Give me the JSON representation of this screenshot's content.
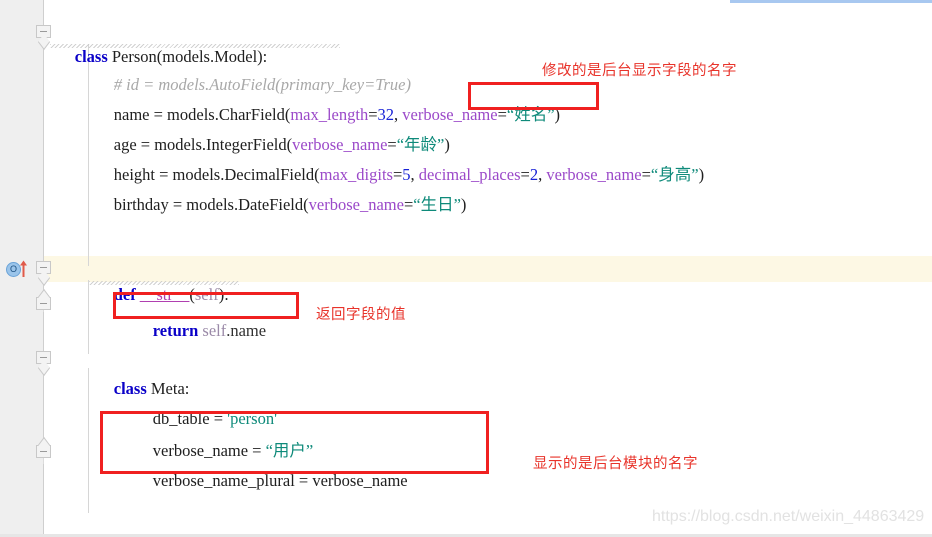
{
  "editor": {
    "background_color": "#ffffff",
    "gutter_color": "#efefef",
    "current_line_highlight_color": "#fdf8e4",
    "top_marker_bar_color": "#a8c8f0",
    "annotation_color": "#f02020"
  },
  "gutter": {
    "override_icon_letter": "O",
    "override_icon_title": "Overrides method in Model",
    "fold_markers": [
      "fold-class-person",
      "fold-def-str",
      "fold-def-str-body",
      "fold-class-meta",
      "fold-class-meta-body"
    ]
  },
  "code": {
    "lines": [
      {
        "id": "line-class-person",
        "indent": 0,
        "tokens": [
          {
            "t": "class ",
            "c": "kw"
          },
          {
            "t": "Person",
            "c": "ident"
          },
          {
            "t": "(models.Model):",
            "c": "ident"
          }
        ],
        "plain": "class Person(models.Model):"
      },
      {
        "id": "line-comment-id",
        "indent": 1,
        "tokens": [
          {
            "t": "# id = models.AutoField(primary_key=True)",
            "c": "comment"
          }
        ],
        "plain": "# id = models.AutoField(primary_key=True)"
      },
      {
        "id": "line-field-name",
        "indent": 1,
        "tokens": [
          {
            "t": "name = models.CharField(",
            "c": "ident"
          },
          {
            "t": "max_length",
            "c": "kwarg"
          },
          {
            "t": "=",
            "c": "ident"
          },
          {
            "t": "32",
            "c": "num"
          },
          {
            "t": ", ",
            "c": "ident"
          },
          {
            "t": "verbose_name",
            "c": "kwarg"
          },
          {
            "t": "=",
            "c": "ident"
          },
          {
            "t": "“姓名”",
            "c": "str"
          },
          {
            "t": ")",
            "c": "ident"
          }
        ],
        "plain": "name = models.CharField(max_length=32, verbose_name=“姓名”)"
      },
      {
        "id": "line-field-age",
        "indent": 1,
        "tokens": [
          {
            "t": "age = models.IntegerField(",
            "c": "ident"
          },
          {
            "t": "verbose_name",
            "c": "kwarg"
          },
          {
            "t": "=",
            "c": "ident"
          },
          {
            "t": "“年龄”",
            "c": "str"
          },
          {
            "t": ")",
            "c": "ident"
          }
        ],
        "plain": "age = models.IntegerField(verbose_name=“年龄”)"
      },
      {
        "id": "line-field-height",
        "indent": 1,
        "tokens": [
          {
            "t": "height = models.DecimalField(",
            "c": "ident"
          },
          {
            "t": "max_digits",
            "c": "kwarg"
          },
          {
            "t": "=",
            "c": "ident"
          },
          {
            "t": "5",
            "c": "num"
          },
          {
            "t": ", ",
            "c": "ident"
          },
          {
            "t": "decimal_places",
            "c": "kwarg"
          },
          {
            "t": "=",
            "c": "ident"
          },
          {
            "t": "2",
            "c": "num"
          },
          {
            "t": ", ",
            "c": "ident"
          },
          {
            "t": "verbose_name",
            "c": "kwarg"
          },
          {
            "t": "=",
            "c": "ident"
          },
          {
            "t": "“身高”",
            "c": "str"
          },
          {
            "t": ")",
            "c": "ident"
          }
        ],
        "plain": "height = models.DecimalField(max_digits=5, decimal_places=2, verbose_name=“身高”)"
      },
      {
        "id": "line-field-birthday",
        "indent": 1,
        "tokens": [
          {
            "t": "birthday = models.DateField(",
            "c": "ident"
          },
          {
            "t": "verbose_name",
            "c": "kwarg"
          },
          {
            "t": "=",
            "c": "ident"
          },
          {
            "t": "“生日”",
            "c": "str"
          },
          {
            "t": ")",
            "c": "ident"
          }
        ],
        "plain": "birthday = models.DateField(verbose_name=“生日”)"
      },
      {
        "id": "line-def-str",
        "indent": 1,
        "tokens": [
          {
            "t": "def ",
            "c": "kw"
          },
          {
            "t": "__str__",
            "c": "dunder"
          },
          {
            "t": "(",
            "c": "ident"
          },
          {
            "t": "self",
            "c": "selfkw"
          },
          {
            "t": "):",
            "c": "ident"
          }
        ],
        "plain": "def __str__(self):"
      },
      {
        "id": "line-return-self-name",
        "indent": 2,
        "tokens": [
          {
            "t": "return ",
            "c": "kw"
          },
          {
            "t": "self",
            "c": "selfkw"
          },
          {
            "t": ".name",
            "c": "attr"
          }
        ],
        "plain": "return self.name"
      },
      {
        "id": "line-class-meta",
        "indent": 1,
        "tokens": [
          {
            "t": "class ",
            "c": "kw"
          },
          {
            "t": "Meta:",
            "c": "ident"
          }
        ],
        "plain": "class Meta:"
      },
      {
        "id": "line-db-table",
        "indent": 2,
        "tokens": [
          {
            "t": "db_table = ",
            "c": "ident"
          },
          {
            "t": "'person'",
            "c": "str"
          }
        ],
        "plain": "db_table = 'person'"
      },
      {
        "id": "line-meta-verbose-name",
        "indent": 2,
        "tokens": [
          {
            "t": "verbose_name = ",
            "c": "ident"
          },
          {
            "t": "“用户”",
            "c": "str"
          }
        ],
        "plain": "verbose_name = “用户”"
      },
      {
        "id": "line-meta-verbose-name-plural",
        "indent": 2,
        "tokens": [
          {
            "t": "verbose_name_plural = verbose_name",
            "c": "ident"
          }
        ],
        "plain": "verbose_name_plural = verbose_name"
      }
    ]
  },
  "annotations": {
    "note_verbose_name": "修改的是后台显示字段的名字",
    "note_return": "返回字段的值",
    "note_meta": "显示的是后台模块的名字"
  },
  "watermark": {
    "text": "https://blog.csdn.net/weixin_44863429"
  }
}
